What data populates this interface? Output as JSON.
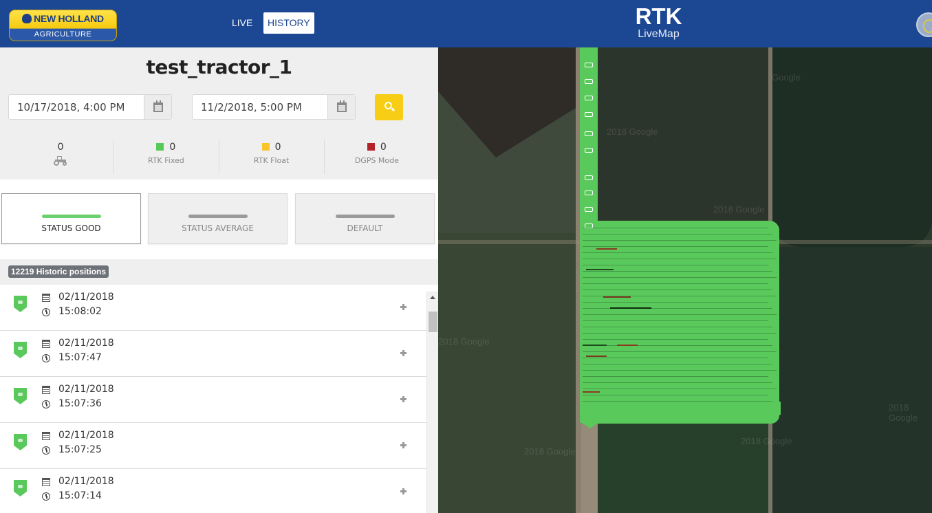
{
  "header": {
    "brand_top": "NEW HOLLAND",
    "brand_bottom": "AGRICULTURE",
    "nav": [
      {
        "label": "LIVE",
        "active": false
      },
      {
        "label": "HISTORY",
        "active": true
      }
    ],
    "app_title": "RTK",
    "app_subtitle": "LiveMap",
    "brand_color": "#1c4792"
  },
  "sidebar": {
    "device_name": "test_tractor_1",
    "date_from": "10/17/2018, 4:00 PM",
    "date_to": "11/2/2018, 5:00 PM",
    "stats": [
      {
        "value": "0",
        "label": "",
        "icon": "tractor-icon",
        "color": null
      },
      {
        "value": "0",
        "label": "RTK Fixed",
        "icon": "square",
        "color": "#5ac95c"
      },
      {
        "value": "0",
        "label": "RTK Float",
        "icon": "square",
        "color": "#f8c52d"
      },
      {
        "value": "0",
        "label": "DGPS Mode",
        "icon": "square",
        "color": "#b32428"
      }
    ],
    "filters": [
      {
        "label": "STATUS GOOD",
        "bar_color": "#6bd06d",
        "active": true
      },
      {
        "label": "STATUS AVERAGE",
        "bar_color": "#9a9a9a",
        "active": false
      },
      {
        "label": "DEFAULT",
        "bar_color": "#9a9a9a",
        "active": false
      }
    ],
    "positions_count_label": "12219 Historic positions",
    "positions": [
      {
        "date": "02/11/2018",
        "time": "15:08:02"
      },
      {
        "date": "02/11/2018",
        "time": "15:07:47"
      },
      {
        "date": "02/11/2018",
        "time": "15:07:36"
      },
      {
        "date": "02/11/2018",
        "time": "15:07:25"
      },
      {
        "date": "02/11/2018",
        "time": "15:07:14"
      }
    ]
  },
  "map": {
    "watermarks": [
      "Google",
      "2018 Google",
      "2018 Google",
      "2018 Google",
      "2018 Google",
      "2018 Google",
      "2018 Google"
    ],
    "track_color": "#5ac95c"
  }
}
